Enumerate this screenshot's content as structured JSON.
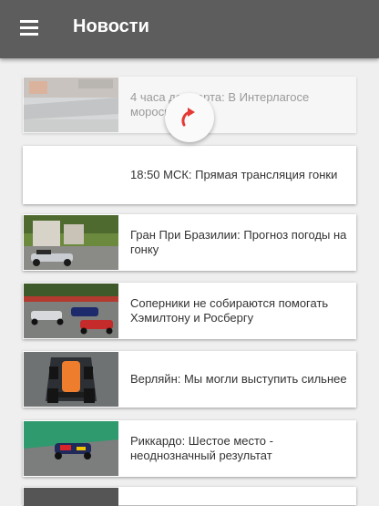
{
  "app_bar": {
    "title": "Новости",
    "menu_icon": "hamburger-menu-icon"
  },
  "refresh_indicator": {
    "icon": "refresh-arrow-icon",
    "color": "#e53935"
  },
  "news": [
    {
      "text": "4 часа до старта: В Интерлагосе моросит дождь",
      "image": "rainy-track-photo"
    },
    {
      "text": "18:50 МСК: Прямая трансляция гонки",
      "image": ""
    },
    {
      "text": "Гран При Бразилии: Прогноз погоды на гонку",
      "image": "mercedes-car-photo"
    },
    {
      "text": "Соперники не собираются помогать Хэмилтону и Росбергу",
      "image": "race-start-photo"
    },
    {
      "text": "Верляйн: Мы могли выступить сильнее",
      "image": "manor-car-photo"
    },
    {
      "text": "Риккардо: Шестое место - неоднозначный результат",
      "image": "red-bull-car-photo"
    }
  ]
}
